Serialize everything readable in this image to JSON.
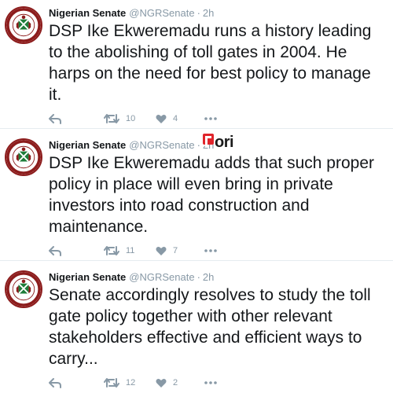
{
  "colors": {
    "text": "#14171a",
    "muted": "#8899a6",
    "divider": "#e6ecf0",
    "avatar_ring": "#8c1c1c",
    "avatar_green": "#1e7d3a",
    "watermark_red": "#e0242b"
  },
  "watermark": {
    "brand": "ori"
  },
  "tweets": [
    {
      "name": "Nigerian Senate",
      "handle": "@NGRSenate",
      "separator": "·",
      "time": "2h",
      "text": "DSP Ike Ekweremadu runs a history leading to the abolishing of toll gates in 2004. He harps on the need for best policy to manage it.",
      "retweets": "10",
      "likes": "4"
    },
    {
      "name": "Nigerian Senate",
      "handle": "@NGRSenate",
      "separator": "·",
      "time": "2h",
      "text": "DSP Ike Ekweremadu adds that such proper policy in place will even bring in private investors into road construction and maintenance.",
      "retweets": "11",
      "likes": "7"
    },
    {
      "name": "Nigerian Senate",
      "handle": "@NGRSenate",
      "separator": "·",
      "time": "2h",
      "text": "Senate accordingly resolves to study the toll gate policy together with other relevant stakeholders effective and efficient ways to carry...",
      "retweets": "12",
      "likes": "2"
    }
  ],
  "icons": {
    "avatar": "senate-seal-icon",
    "reply": "reply-icon",
    "retweet": "retweet-icon",
    "like": "heart-icon",
    "more": "more-icon"
  }
}
